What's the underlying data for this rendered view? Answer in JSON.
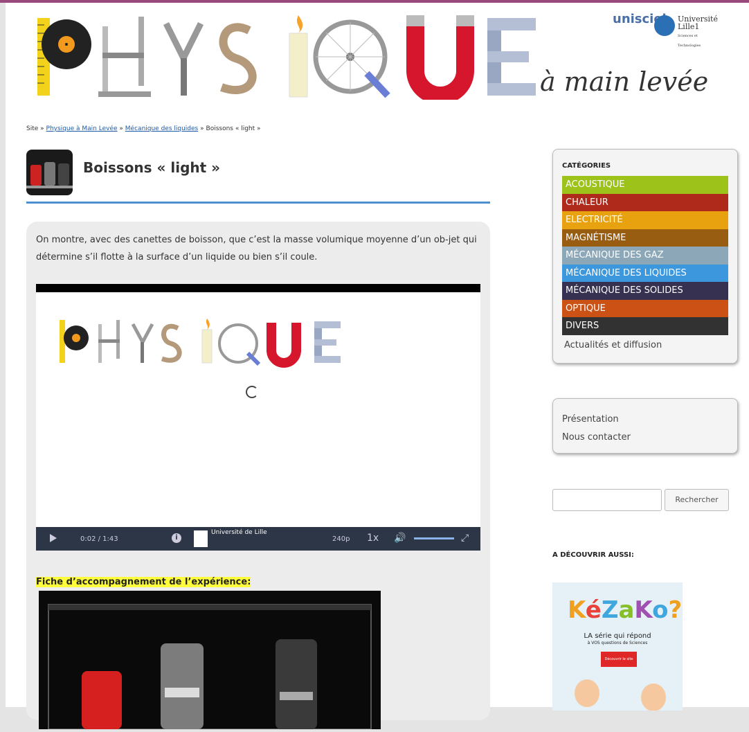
{
  "header": {
    "title_letters": [
      "P",
      "H",
      "Y",
      "S",
      "I",
      "Q",
      "U",
      "E"
    ],
    "subtitle": "à main levée",
    "logo_unisciel": "unisciel",
    "logo_lille_name": "Université Lille1",
    "logo_lille_sub": "Sciences et Technologies"
  },
  "breadcrumb": {
    "root": "Site",
    "sep": "»",
    "item1": "Physique à Main Levée",
    "item2": "Mécanique des liquides",
    "current": "Boissons « light »"
  },
  "post": {
    "title": "Boissons « light »",
    "intro": "On montre, avec des canettes de boisson, que c’est la masse volumique moyenne d’un ob-jet qui détermine s’il flotte à la surface d’un liquide ou bien s’il coule.",
    "fiche_label": "Fiche d’accompagnement de l’expérience:"
  },
  "video": {
    "time": "0:02  /  1:43",
    "info": "i",
    "brand": "Université de Lille",
    "quality": "240p",
    "speed": "1x",
    "volume_icon": "speaker-icon",
    "fullscreen_icon": "fullscreen-icon",
    "progress": 0.02
  },
  "sidebar": {
    "categories_heading": "CATÉGORIES",
    "categories": [
      {
        "label": "ACOUSTIQUE",
        "color": "#9dc31b"
      },
      {
        "label": "CHALEUR",
        "color": "#b02a1c"
      },
      {
        "label": "ELECTRICITÉ",
        "color": "#e8a20f"
      },
      {
        "label": "MAGNÉTISME",
        "color": "#985d10"
      },
      {
        "label": "MÉCANIQUE DES GAZ",
        "color": "#8ba7b8"
      },
      {
        "label": "MÉCANIQUE DES LIQUIDES",
        "color": "#3d97dc"
      },
      {
        "label": "MÉCANIQUE DES SOLIDES",
        "color": "#363151"
      },
      {
        "label": "OPTIQUE",
        "color": "#cb5114"
      },
      {
        "label": "DIVERS",
        "color": "#323232"
      }
    ],
    "actualites": "Actualités et diffusion",
    "pages": [
      "Présentation",
      "Nous contacter"
    ],
    "search_button": "Rechercher",
    "search_placeholder": "",
    "discover_heading": "A DÉCOUVRIR AUSSI:",
    "kezako": {
      "title": "KéZaKo?",
      "line1": "LA série qui répond",
      "line2": "à VOS questions de Sciences",
      "button": "Découvrir le site"
    }
  }
}
